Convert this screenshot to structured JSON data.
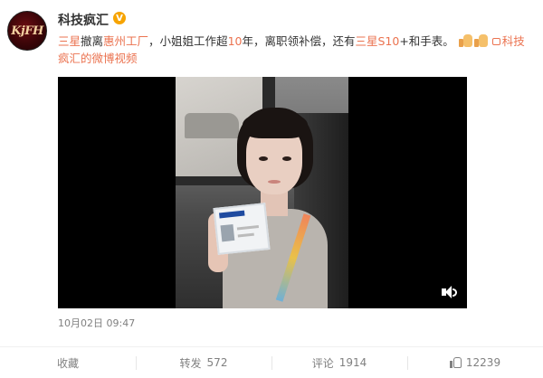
{
  "author": {
    "name": "科技疯汇",
    "avatar_text": "KjFH",
    "verified_badge": "V",
    "verified_color": "#f7a400"
  },
  "post": {
    "segments": [
      {
        "text": "三星",
        "highlight": true
      },
      {
        "text": "撤离",
        "highlight": false
      },
      {
        "text": "惠州工厂",
        "highlight": true
      },
      {
        "text": "，小姐姐工作超",
        "highlight": false
      },
      {
        "text": "10",
        "highlight": true
      },
      {
        "text": "年，离职领补偿，还有",
        "highlight": false
      },
      {
        "text": "三星S10",
        "highlight": true
      },
      {
        "text": "+和手表。",
        "highlight": false
      }
    ],
    "emoji_icon": "thumbs-up-icon",
    "link_text": "科技疯汇的微博视频",
    "accent_color": "#eb7350",
    "timestamp": "10月02日 09:47"
  },
  "video": {
    "volume_icon": "speaker-icon"
  },
  "actions": {
    "favorite_label": "收藏",
    "repost_label": "转发",
    "repost_count": "572",
    "comment_label": "评论",
    "comment_count": "1914",
    "like_count": "12239"
  }
}
